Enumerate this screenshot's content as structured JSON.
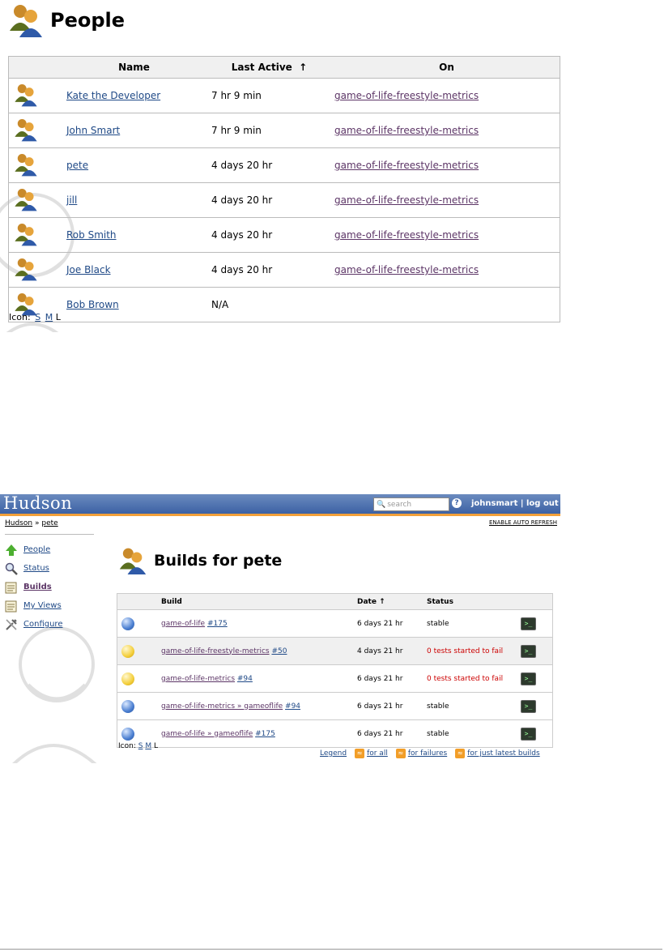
{
  "people_page": {
    "title": "People",
    "columns": {
      "icon": "",
      "name": "Name",
      "last_active": "Last Active",
      "sort_arrow": "↑",
      "on": "On"
    },
    "rows": [
      {
        "name": "Kate the Developer",
        "last_active": "7 hr 9 min",
        "on": "game-of-life-freestyle-metrics"
      },
      {
        "name": "John Smart",
        "last_active": "7 hr 9 min",
        "on": "game-of-life-freestyle-metrics"
      },
      {
        "name": "pete",
        "last_active": "4 days 20 hr",
        "on": "game-of-life-freestyle-metrics"
      },
      {
        "name": "jill",
        "last_active": "4 days 20 hr",
        "on": "game-of-life-freestyle-metrics"
      },
      {
        "name": "Rob Smith",
        "last_active": "4 days 20 hr",
        "on": "game-of-life-freestyle-metrics"
      },
      {
        "name": "Joe Black",
        "last_active": "4 days 20 hr",
        "on": "game-of-life-freestyle-metrics"
      },
      {
        "name": "Bob Brown",
        "last_active": "N/A",
        "on": ""
      }
    ],
    "icon_size": {
      "label": "Icon:",
      "s": "S",
      "m": "M",
      "l": "L"
    }
  },
  "hudson": {
    "logo": "Hudson",
    "search_placeholder": "search",
    "help": "?",
    "user": "johnsmart",
    "separator": " | ",
    "logout": "log out",
    "breadcrumb": {
      "root": "Hudson",
      "sep": "»",
      "current": "pete"
    },
    "auto_refresh": "ENABLE AUTO REFRESH",
    "sidebar": [
      "People",
      "Status",
      "Builds",
      "My Views",
      "Configure"
    ],
    "title": "Builds for pete",
    "columns": {
      "build": "Build",
      "date": "Date",
      "sort_arrow": "↑",
      "status": "Status"
    },
    "builds": [
      {
        "status_color": "blue",
        "job": "game-of-life",
        "number": "#175",
        "date": "6 days 21 hr",
        "status": "stable"
      },
      {
        "status_color": "yellow",
        "job": "game-of-life-freestyle-metrics",
        "number": "#50",
        "date": "4 days 21 hr",
        "status": "0 tests started to fail"
      },
      {
        "status_color": "yellow",
        "job": "game-of-life-metrics",
        "number": "#94",
        "date": "6 days 21 hr",
        "status": "0 tests started to fail"
      },
      {
        "status_color": "blue",
        "job": "game-of-life-metrics » gameoflife",
        "number": "#94",
        "date": "6 days 21 hr",
        "status": "stable"
      },
      {
        "status_color": "blue",
        "job": "game-of-life » gameoflife",
        "number": "#175",
        "date": "6 days 21 hr",
        "status": "stable"
      }
    ],
    "icon_size": {
      "label": "Icon:",
      "s": "S",
      "m": "M",
      "l": "L"
    },
    "legend": "Legend",
    "rss_all": "for all",
    "rss_failures": "for failures",
    "rss_latest": "for just latest builds"
  },
  "colors": {
    "header_blue": "#3c61a4",
    "header_accent": "#f2a03a",
    "fail_red": "#cc0000",
    "link": "#204a87",
    "visited": "#5c3566"
  }
}
